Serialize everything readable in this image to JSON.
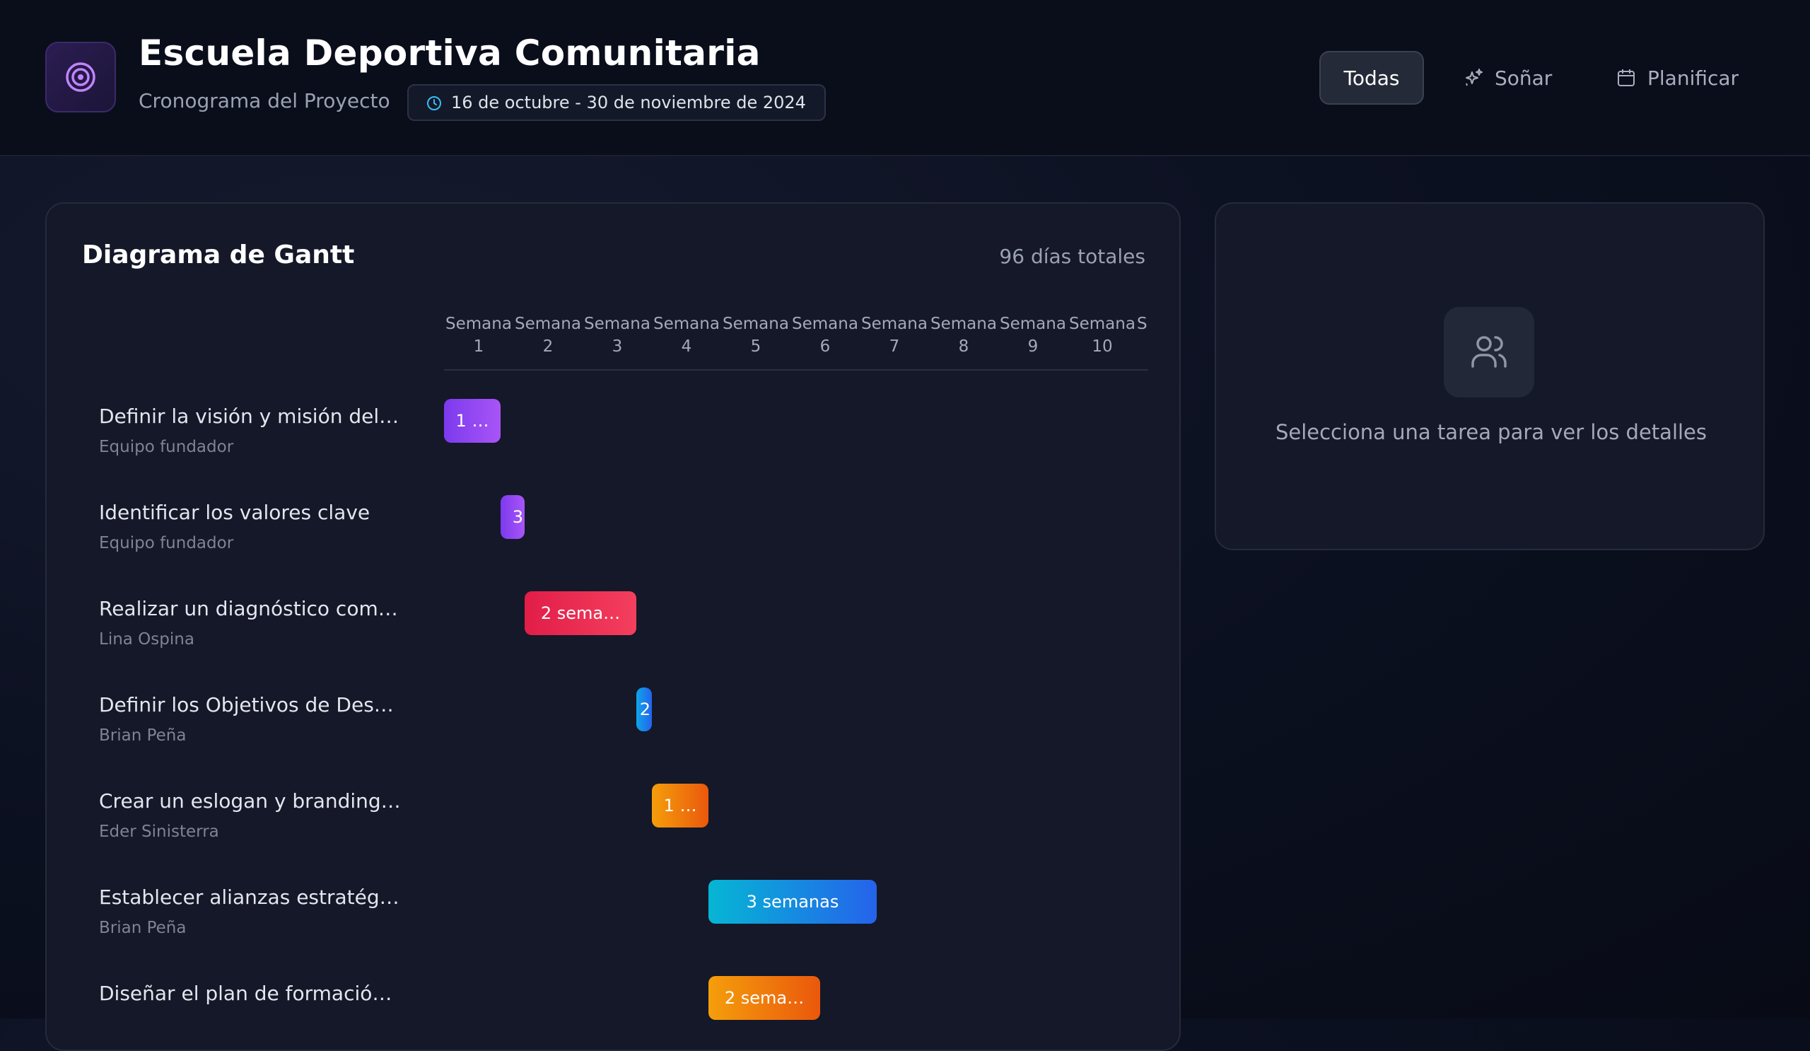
{
  "header": {
    "title": "Escuela Deportiva Comunitaria",
    "subtitle": "Cronograma del Proyecto",
    "date_range": "16 de octubre - 30 de noviembre de 2024",
    "nav": [
      {
        "label": "Todas",
        "active": true,
        "icon": "none"
      },
      {
        "label": "Soñar",
        "active": false,
        "icon": "sparkles-icon"
      },
      {
        "label": "Planificar",
        "active": false,
        "icon": "calendar-icon"
      }
    ]
  },
  "gantt": {
    "title": "Diagrama de Gantt",
    "total_days": "96 días totales",
    "weeks": [
      {
        "label": "Semana",
        "num": "1"
      },
      {
        "label": "Semana",
        "num": "2"
      },
      {
        "label": "Semana",
        "num": "3"
      },
      {
        "label": "Semana",
        "num": "4"
      },
      {
        "label": "Semana",
        "num": "5"
      },
      {
        "label": "Semana",
        "num": "6"
      },
      {
        "label": "Semana",
        "num": "7"
      },
      {
        "label": "Semana",
        "num": "8"
      },
      {
        "label": "Semana",
        "num": "9"
      },
      {
        "label": "Semana",
        "num": "10"
      },
      {
        "label": "S",
        "num": ""
      }
    ],
    "tasks": [
      {
        "name": "Definir la visión y misión del…",
        "owner": "Equipo fundador",
        "bar_label": "1 …",
        "color": "purple"
      },
      {
        "name": "Identificar los valores clave",
        "owner": "Equipo fundador",
        "bar_label": "3",
        "color": "purple"
      },
      {
        "name": "Realizar un diagnóstico com…",
        "owner": "Lina Ospina",
        "bar_label": "2 sema…",
        "color": "red"
      },
      {
        "name": "Definir los Objetivos de Des…",
        "owner": "Brian Peña",
        "bar_label": "2",
        "color": "blue"
      },
      {
        "name": "Crear un eslogan y branding…",
        "owner": "Eder Sinisterra",
        "bar_label": "1 …",
        "color": "orange"
      },
      {
        "name": "Establecer alianzas estratég…",
        "owner": "Brian Peña",
        "bar_label": "3 semanas",
        "color": "cyan"
      },
      {
        "name": "Diseñar el plan de formació…",
        "owner": "",
        "bar_label": "2 sema…",
        "color": "orange"
      }
    ]
  },
  "details": {
    "empty_message": "Selecciona una tarea para ver los detalles",
    "icon": "users-icon"
  },
  "colors": {
    "purple": "#8b5cf6",
    "red": "#f43f5e",
    "blue": "#0ea5e9",
    "orange": "#f59e0b",
    "cyan": "#06b6d4"
  }
}
